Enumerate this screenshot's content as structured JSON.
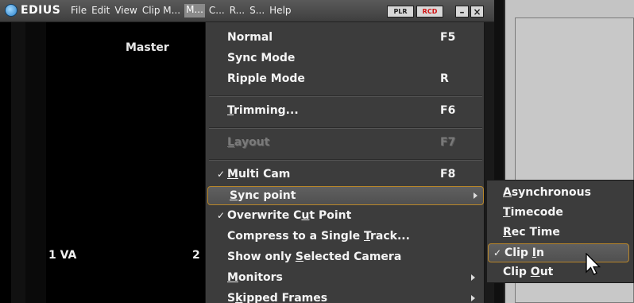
{
  "app": {
    "name": "EDIUS"
  },
  "menubar": {
    "items": [
      "File",
      "Edit",
      "View",
      "Clip M...",
      "M...",
      "C...",
      "R...",
      "S...",
      "Help"
    ],
    "active_index": 4
  },
  "window_controls": {
    "plr": "PLR",
    "rcd": "RCD",
    "minimize": "–",
    "close": "×"
  },
  "left_panel": {
    "master_label": "Master",
    "track_label": "1 VA",
    "track_number": "2"
  },
  "menu": {
    "items": [
      {
        "type": "item",
        "checked": false,
        "label_parts": [
          "Normal"
        ],
        "underline_index": -1,
        "key": "F5",
        "submenu": false,
        "disabled": false,
        "highlight": false
      },
      {
        "type": "item",
        "checked": false,
        "label_parts": [
          "Sync Mode"
        ],
        "underline_index": -1,
        "key": "",
        "submenu": false,
        "disabled": false,
        "highlight": false
      },
      {
        "type": "item",
        "checked": false,
        "label_parts": [
          "Ripple Mode"
        ],
        "underline_index": -1,
        "key": "R",
        "submenu": false,
        "disabled": false,
        "highlight": false
      },
      {
        "type": "separator"
      },
      {
        "type": "item",
        "checked": false,
        "label_parts": [
          "",
          "T",
          "rimming..."
        ],
        "key": "F6",
        "submenu": false,
        "disabled": false,
        "highlight": false
      },
      {
        "type": "separator"
      },
      {
        "type": "item",
        "checked": false,
        "label_parts": [
          "",
          "L",
          "ayout"
        ],
        "key": "F7",
        "submenu": false,
        "disabled": true,
        "highlight": false
      },
      {
        "type": "separator"
      },
      {
        "type": "item",
        "checked": true,
        "label_parts": [
          "",
          "M",
          "ulti Cam"
        ],
        "key": "F8",
        "submenu": false,
        "disabled": false,
        "highlight": false
      },
      {
        "type": "item",
        "checked": false,
        "label_parts": [
          "",
          "S",
          "ync point"
        ],
        "key": "",
        "submenu": true,
        "disabled": false,
        "highlight": true
      },
      {
        "type": "item",
        "checked": true,
        "label_parts": [
          "Overwrite C",
          "u",
          "t Point"
        ],
        "key": "",
        "submenu": false,
        "disabled": false,
        "highlight": false
      },
      {
        "type": "item",
        "checked": false,
        "label_parts": [
          "Compress to a Single ",
          "T",
          "rack..."
        ],
        "key": "",
        "submenu": false,
        "disabled": false,
        "highlight": false
      },
      {
        "type": "item",
        "checked": false,
        "label_parts": [
          "Show only ",
          "S",
          "elected Camera"
        ],
        "key": "",
        "submenu": false,
        "disabled": false,
        "highlight": false
      },
      {
        "type": "item",
        "checked": false,
        "label_parts": [
          "",
          "M",
          "onitors"
        ],
        "key": "",
        "submenu": true,
        "disabled": false,
        "highlight": false
      },
      {
        "type": "item",
        "checked": false,
        "label_parts": [
          "S",
          "k",
          "ipped Frames"
        ],
        "key": "",
        "submenu": true,
        "disabled": false,
        "highlight": false
      }
    ]
  },
  "submenu": {
    "items": [
      {
        "checked": false,
        "label_parts": [
          "",
          "A",
          "synchronous"
        ],
        "highlight": false
      },
      {
        "checked": false,
        "label_parts": [
          "",
          "T",
          "imecode"
        ],
        "highlight": false
      },
      {
        "checked": false,
        "label_parts": [
          "",
          "R",
          "ec Time"
        ],
        "highlight": false
      },
      {
        "checked": true,
        "label_parts": [
          "Clip ",
          "I",
          "n"
        ],
        "highlight": true
      },
      {
        "checked": false,
        "label_parts": [
          "Clip ",
          "O",
          "ut"
        ],
        "highlight": false
      }
    ]
  },
  "colors": {
    "menu_bg": "#3c3c3c",
    "highlight_border": "#b8862a",
    "rcd_red": "#d01010"
  }
}
